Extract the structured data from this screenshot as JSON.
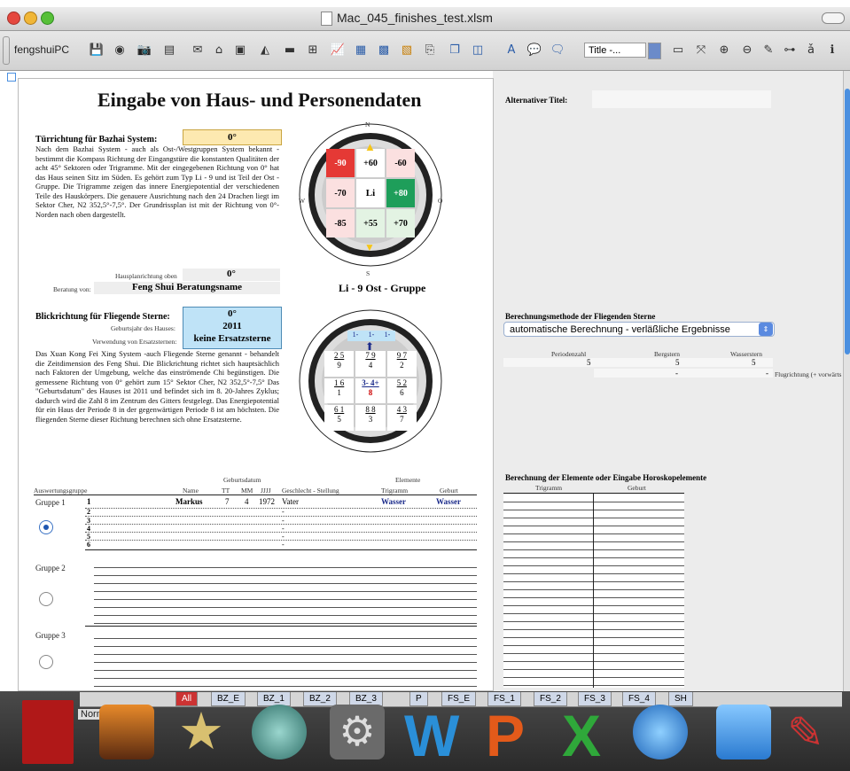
{
  "window": {
    "title": "Mac_045_finishes_test.xlsm"
  },
  "toolbar": {
    "app_name": "fengshuiPC",
    "style_select": "Title -...",
    "icons": [
      "save-icon",
      "color-wheel-icon",
      "camera-icon",
      "print-icon",
      "mail-icon",
      "home-icon",
      "frame-icon",
      "eraser-icon",
      "rectangle-icon",
      "grid-icon",
      "chart-icon",
      "table-icon",
      "table2-icon",
      "image-icon",
      "export-icon",
      "copy-icon",
      "layers-icon",
      "text-box-icon",
      "comment-icon",
      "chat-icon",
      "zoom-in-icon",
      "zoom-out-icon",
      "fullscreen-icon",
      "edit-icon",
      "tree-icon",
      "spell-icon",
      "info-icon"
    ]
  },
  "sheet": {
    "title": "Eingabe von Haus- und Personendaten",
    "door_label": "Türrichtung für Bazhai System:",
    "door_value": "0°",
    "door_text": "Nach dem Bazhai System - auch als Ost-/Westgruppen System bekannt - bestimmt die Kompass Richtung der Eingangstüre die konstanten Qualitäten der acht 45° Sektoren oder Trigramme. Mit der eingegebenen Richtung von 0° hat das Haus seinen Sitz im Süden. Es gehört zum Typ Li - 9 und ist Teil der Ost - Gruppe. Die Trigramme zeigen das innere Energiepotential der verschiedenen Teile des Hauskörpers. Die genauere Ausrichtung nach den 24 Drachen liegt im Sektor Cher, N2 352,5°-7,5°. Der Grundrissplan ist mit der Richtung von 0°- Norden nach oben dargestellt.",
    "plan_dir_label": "Hausplanrichtung oben",
    "plan_dir_value": "0°",
    "consult_label": "Beratung von:",
    "consult_value": "Feng Shui Beratungsname",
    "group_caption": "Li - 9  Ost - Gruppe",
    "view_label": "Blickrichtung für Fliegende Sterne:",
    "view_value": "0°",
    "year_label": "Geburtsjahr des Hauses:",
    "year_value": "2011",
    "subst_label": "Verwendung von Ersatzsternen:",
    "subst_value": "keine Ersatzsterne",
    "view_text": "Das Xuan Kong Fei Xing System -auch Fliegende Sterne genannt - behandelt die Zeitdimension des Feng Shui. Die Blickrichtung richtet sich hauptsächlich nach Faktoren der Umgebung, welche das einströmende Chi begünstigen. Die gemessene Richtung von 0° gehört zum 15° Sektor Cher, N2 352,5°-7,5° Das \"Geburtsdatum\" des Hauses ist 2011 und befindet sich im 8. 20-Jahres Zyklus; dadurch wird die Zahl 8 im Zentrum des Gitters festgelegt. Das Energiepotential für ein Haus der Periode 8 in der gegenwärtigen Periode 8 ist am höchsten. Die fliegenden Sterne dieser Richtung berechnen sich ohne Ersatzsterne.",
    "bazhai_grid": [
      "-90",
      "+60",
      "-60",
      "-70",
      "Li",
      "+80",
      "-85",
      "+55",
      "+70"
    ],
    "compass_marks": [
      "340°",
      "N",
      "10°",
      "20°",
      "320°",
      "40°",
      "310°",
      "50°",
      "300°",
      "60°",
      "290°",
      "70°",
      "W",
      "O",
      "260°",
      "100°",
      "250°",
      "110°",
      "240°",
      "120°",
      "230°",
      "130°",
      "220°",
      "140°",
      "210°",
      "150°",
      "200°",
      "S",
      "170°",
      "160°",
      "190°"
    ],
    "fs_grid": [
      [
        "2 5",
        "9"
      ],
      [
        "7 9",
        "4"
      ],
      [
        "9 7",
        "2"
      ],
      [
        "1 6",
        "1"
      ],
      [
        "3- 4+",
        "8"
      ],
      [
        "5 2",
        "6"
      ],
      [
        "6 1",
        "5"
      ],
      [
        "8 8",
        "3"
      ],
      [
        "4 3",
        "7"
      ]
    ],
    "fs_top": [
      "1-",
      "1-",
      "1-"
    ],
    "fs_ring": [
      "3+",
      "3-",
      "4-",
      "4+",
      "4-",
      "4-"
    ],
    "table_head": {
      "geb": "Geburtsdatum",
      "elem": "Elemente",
      "group": "Auswertungsgruppe",
      "name": "Name",
      "tt": "TT",
      "mm": "MM",
      "jjjj": "JJJJ",
      "gender": "Geschlecht - Stellung",
      "trigram": "Trigramm",
      "birth": "Geburt"
    },
    "group1": "Gruppe 1",
    "group2": "Gruppe 2",
    "group3": "Gruppe 3",
    "row1": {
      "no": "1",
      "name": "Markus",
      "tt": "7",
      "mm": "4",
      "jjjj": "1972",
      "gender": "Vater",
      "trigram": "Wasser",
      "birth": "Wasser"
    },
    "rows": [
      "2",
      "3",
      "4",
      "5",
      "6"
    ],
    "dash": "-"
  },
  "right": {
    "alt_title": "Alternativer Titel:",
    "method_title": "Berechnungsmethode der Fliegenden Sterne",
    "method_value": "automatische Berechnung - verläßliche Ergebnisse",
    "periodenzahl": "Periodenzahl",
    "bergstern": "Bergstern",
    "wasserstern": "Wasserstern",
    "v1": "5",
    "v2": "5",
    "v3": "5",
    "dash1": "-",
    "dash2": "-",
    "flug": "Flugrichtung (+ vorwärts",
    "elem_title": "Berechnung der Elemente oder Eingabe Horoskopelemente",
    "elem_trigram": "Trigramm",
    "elem_geburt": "Geburt"
  },
  "tabs": [
    "All",
    "BZ_E",
    "BZ_1",
    "BZ_2",
    "BZ_3",
    "P",
    "FS_E",
    "FS_1",
    "FS_2",
    "FS_3",
    "FS_4",
    "SH"
  ],
  "sheet_nav": "Normal",
  "colors": {
    "red": "#e53935",
    "green": "#1e9e5a",
    "yellow_box": "#fde9b0",
    "blue_box": "#bfe3f7",
    "dark_blue": "#1a2a8a"
  }
}
